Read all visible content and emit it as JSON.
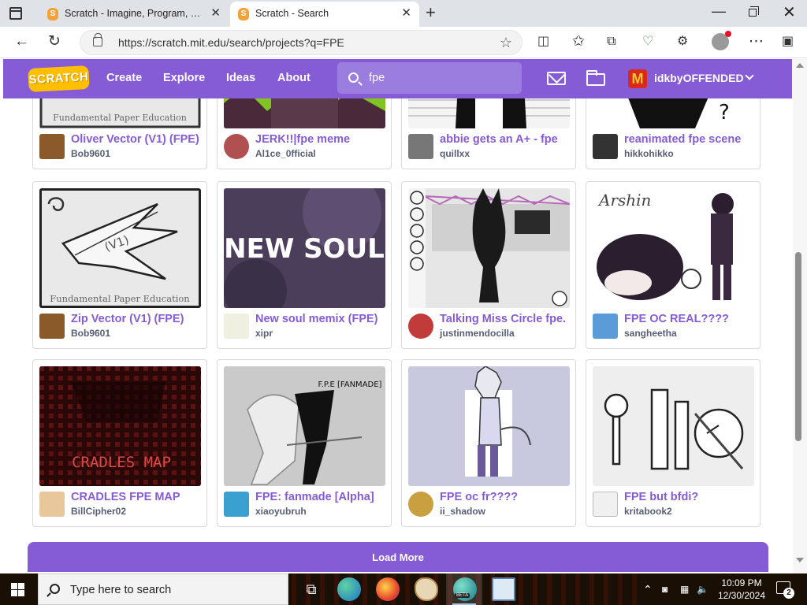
{
  "browser": {
    "tabs": [
      {
        "title": "Scratch - Imagine, Program, Share",
        "active": false
      },
      {
        "title": "Scratch - Search",
        "active": true
      }
    ],
    "new_tab": "+",
    "window_controls": {
      "minimize": "—",
      "close": "✕"
    },
    "address": {
      "url": "https://scratch.mit.edu/search/projects?q=FPE"
    },
    "toolbar_icons": [
      "back-arrow-icon",
      "refresh-icon",
      "split-screen-icon",
      "favorites-icon",
      "collections-icon",
      "browser-essentials-icon",
      "extensions-icon",
      "profile-icon",
      "more-icon",
      "sidebar-icon"
    ]
  },
  "scratch_nav": {
    "logo": "SCRATCH",
    "links": [
      "Create",
      "Explore",
      "Ideas",
      "About"
    ],
    "search_query": "fpe",
    "username": "idkbyOFFENDED",
    "avatar_letter": "M"
  },
  "projects": [
    {
      "title": "Oliver Vector (V1) (FPE)",
      "author": "Bob9601",
      "thumb_caption": "Fundamental Paper Education"
    },
    {
      "title": "JERK!!|fpe meme",
      "author": "Al1ce_0fficial",
      "thumb_caption": ""
    },
    {
      "title": "abbie gets an A+ - fpe",
      "author": "quillxx",
      "thumb_caption": ""
    },
    {
      "title": "reanimated fpe scene",
      "author": "hikkohikko",
      "thumb_caption": "?"
    },
    {
      "title": "Zip Vector (V1) (FPE)",
      "author": "Bob9601",
      "thumb_caption": "Fundamental Paper Education",
      "thumb_extra": "(V1)"
    },
    {
      "title": "New soul memix (FPE)",
      "author": "xipr",
      "thumb_caption": "NEW SOUL"
    },
    {
      "title": "Talking Miss Circle fpe.",
      "author": "justinmendocilla",
      "thumb_caption": ""
    },
    {
      "title": "FPE OC REAL????",
      "author": "sangheetha",
      "thumb_caption": "Arshin"
    },
    {
      "title": "CRADLES FPE MAP",
      "author": "BillCipher02",
      "thumb_caption": "CRADLES MAP"
    },
    {
      "title": "FPE: fanmade [Alpha]",
      "author": "xiaoyubruh",
      "thumb_caption": "F.P.E [FANMADE]"
    },
    {
      "title": "FPE oc fr????",
      "author": "ii_shadow",
      "thumb_caption": ""
    },
    {
      "title": "FPE but bfdi?",
      "author": "kritabook2",
      "thumb_caption": ""
    }
  ],
  "load_more": "Load More",
  "taskbar": {
    "search_placeholder": "Type here to search",
    "time": "10:09 PM",
    "date": "12/30/2024",
    "notification_count": "2",
    "edge_beta_label": "BETA"
  },
  "colors": {
    "scratch_purple": "#855cd6",
    "scratch_orange": "#ffbf00",
    "tab_strip": "#dfe3e8"
  }
}
